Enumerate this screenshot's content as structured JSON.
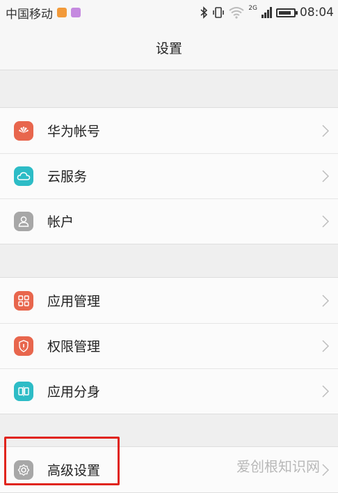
{
  "status_bar": {
    "carrier": "中国移动",
    "network_tag": "2G",
    "time": "08:04",
    "battery_level": 0.85,
    "icons": [
      "photo-notification-icon",
      "gallery-notification-icon",
      "bluetooth-icon",
      "vibrate-icon",
      "wifi-icon",
      "signal-icon",
      "battery-icon"
    ]
  },
  "header": {
    "title": "设置"
  },
  "groups": [
    {
      "items": [
        {
          "label": "华为帐号",
          "icon": "huawei-logo-icon",
          "color": "#e8664d"
        },
        {
          "label": "云服务",
          "icon": "cloud-icon",
          "color": "#2dbcc6"
        },
        {
          "label": "帐户",
          "icon": "person-icon",
          "color": "#a7a7a7"
        }
      ]
    },
    {
      "items": [
        {
          "label": "应用管理",
          "icon": "apps-grid-icon",
          "color": "#e8664d"
        },
        {
          "label": "权限管理",
          "icon": "shield-icon",
          "color": "#e8664d"
        },
        {
          "label": "应用分身",
          "icon": "app-twin-icon",
          "color": "#2dbcc6"
        }
      ]
    },
    {
      "items": [
        {
          "label": "高级设置",
          "icon": "gear-icon",
          "color": "#a7a7a7"
        }
      ]
    }
  ],
  "watermark": "爱创根知识网",
  "colors": {
    "highlight": "#e0241c",
    "background": "#efefef",
    "row": "#fbfbfb"
  }
}
